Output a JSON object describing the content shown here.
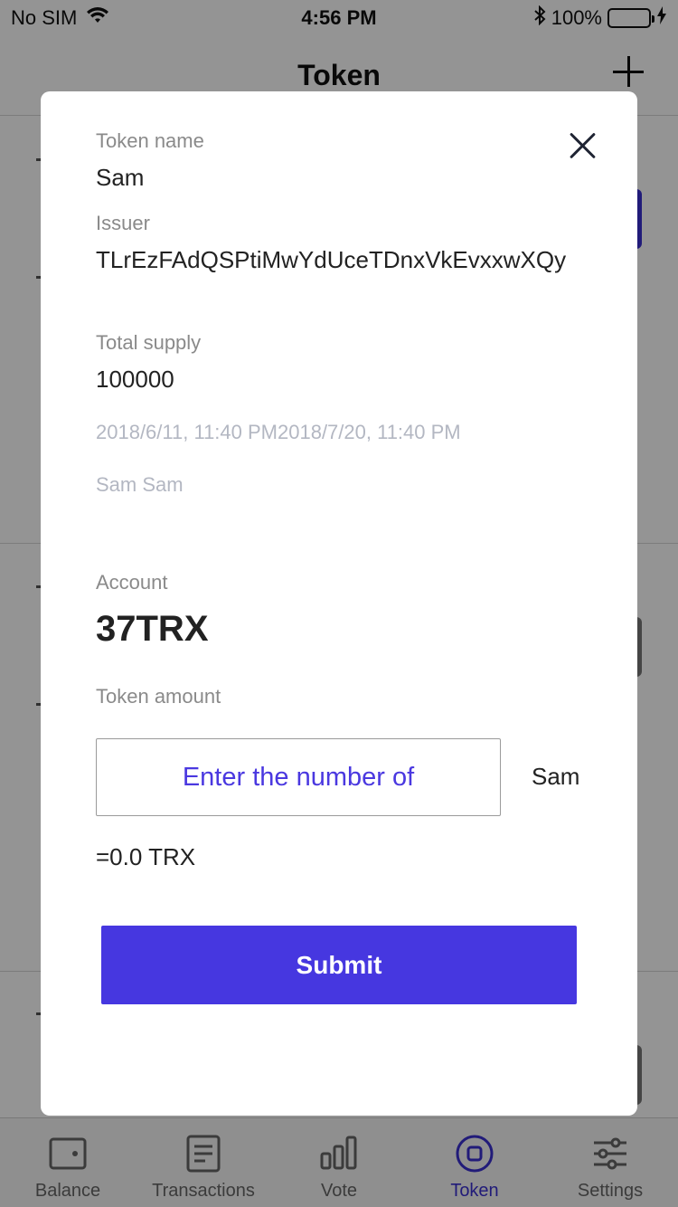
{
  "status_bar": {
    "carrier": "No SIM",
    "time": "4:56 PM",
    "battery": "100%"
  },
  "nav": {
    "title": "Token"
  },
  "tabs": [
    {
      "label": "Balance",
      "icon": "wallet-icon",
      "active": false
    },
    {
      "label": "Transactions",
      "icon": "document-icon",
      "active": false
    },
    {
      "label": "Vote",
      "icon": "bar-chart-icon",
      "active": false
    },
    {
      "label": "Token",
      "icon": "token-icon",
      "active": true
    },
    {
      "label": "Settings",
      "icon": "sliders-icon",
      "active": false
    }
  ],
  "modal": {
    "token_name_label": "Token name",
    "token_name": "Sam",
    "issuer_label": "Issuer",
    "issuer": "TLrEzFAdQSPtiMwYdUceTDnxVkEvxxwXQy",
    "total_supply_label": "Total supply",
    "total_supply": "100000",
    "dates": "2018/6/11, 11:40 PM2018/7/20, 11:40 PM",
    "description": "Sam Sam",
    "account_label": "Account",
    "account_value": "37TRX",
    "token_amount_label": "Token amount",
    "amount_placeholder": "Enter the number of",
    "amount_unit": "Sam",
    "trx_equivalent": "=0.0 TRX",
    "submit_label": "Submit"
  },
  "colors": {
    "accent": "#4637e0",
    "overlay": "rgba(0,0,0,0.42)"
  }
}
